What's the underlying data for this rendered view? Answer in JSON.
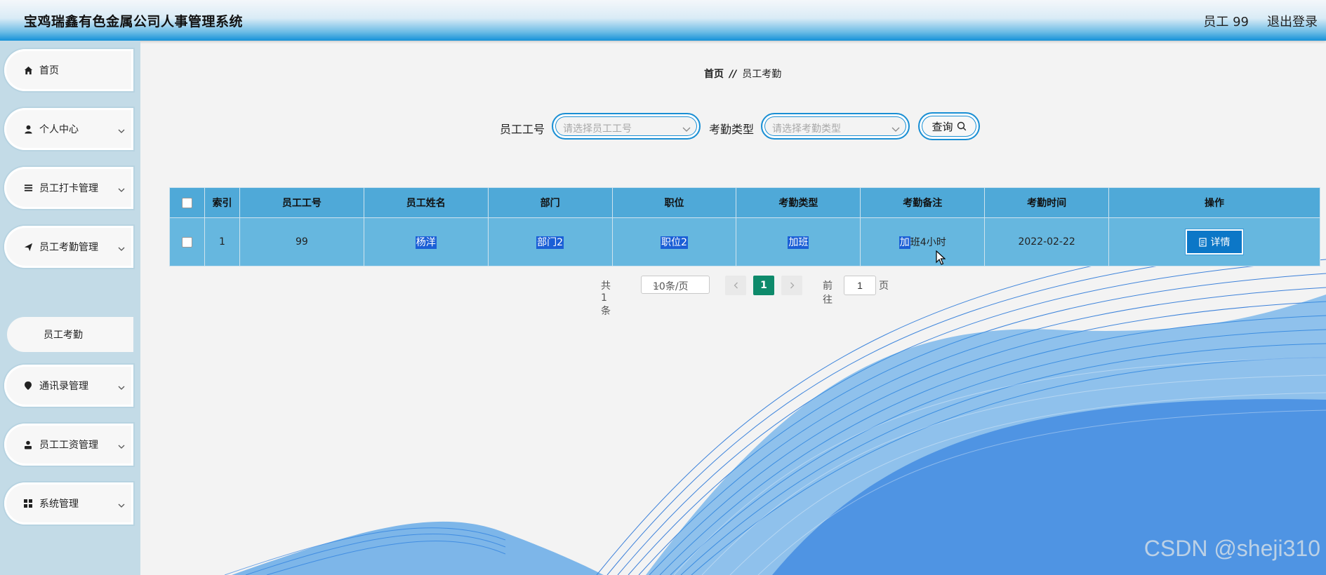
{
  "header": {
    "app_title": "宝鸡瑞鑫有色金属公司人事管理系统",
    "user_label": "员工 99",
    "logout_label": "退出登录"
  },
  "sidebar": {
    "items": [
      {
        "label": "首页",
        "icon": "home-icon"
      },
      {
        "label": "个人中心",
        "icon": "user-icon"
      },
      {
        "label": "员工打卡管理",
        "icon": "list-icon"
      },
      {
        "label": "员工考勤管理",
        "icon": "send-icon"
      },
      {
        "label": "通讯录管理",
        "icon": "pin-icon"
      },
      {
        "label": "员工工资管理",
        "icon": "person-icon"
      },
      {
        "label": "系统管理",
        "icon": "grid-icon"
      }
    ],
    "active_submenu": "员工考勤"
  },
  "breadcrumb": {
    "home": "首页",
    "separator": "//",
    "current": "员工考勤"
  },
  "search": {
    "employee_no_label": "员工工号",
    "employee_no_placeholder": "请选择员工工号",
    "attendance_type_label": "考勤类型",
    "attendance_type_placeholder": "请选择考勤类型",
    "query_label": "查询"
  },
  "table": {
    "columns": [
      "索引",
      "员工工号",
      "员工姓名",
      "部门",
      "职位",
      "考勤类型",
      "考勤备注",
      "考勤时间",
      "操作"
    ],
    "rows": [
      {
        "index": "1",
        "employee_no": "99",
        "name": "杨洋",
        "department": "部门2",
        "position": "职位2",
        "attendance_type": "加班",
        "remark_highlight": "加",
        "remark_rest": "班4小时",
        "time": "2022-02-22",
        "action_label": "详情"
      }
    ]
  },
  "pagination": {
    "total_text": "共 1 条",
    "page_size": "10条/页",
    "current_page": "1",
    "goto_label": "前往",
    "goto_value": "1",
    "page_suffix": "页"
  },
  "watermark": "CSDN @sheji310",
  "colors": {
    "header_blue": "#1592d8",
    "sidebar_bg": "#c3dbe7",
    "table_header": "#4fa9d8",
    "table_row": "#66b7df",
    "pager_active": "#0e8a6b"
  }
}
